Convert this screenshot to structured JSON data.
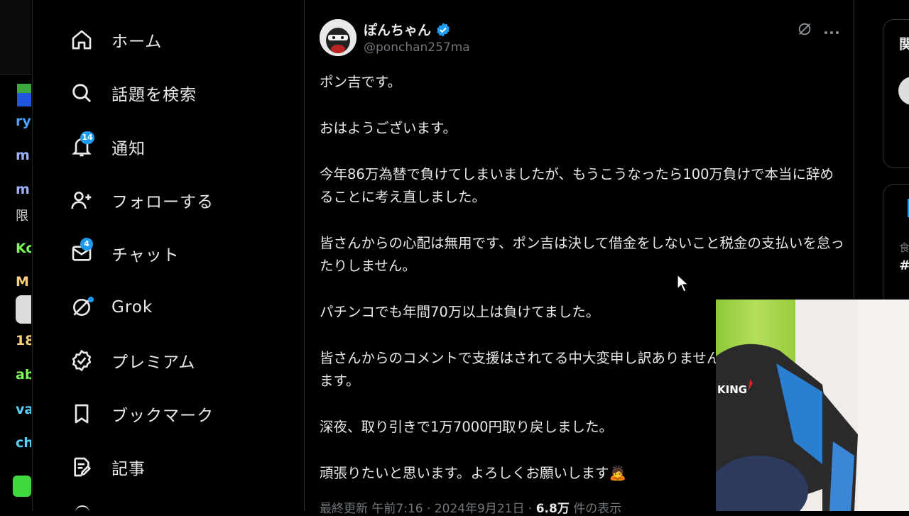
{
  "left_strip": {
    "items": [
      {
        "text": "ry",
        "color": "#4aa3ff"
      },
      {
        "text": "m",
        "color": "#9bb4ff"
      },
      {
        "text": "m",
        "color": "#9bb4ff"
      },
      {
        "text": "限",
        "color": "#cfcfcf"
      },
      {
        "text": "Ko",
        "color": "#7cfc5a"
      },
      {
        "text": "M",
        "color": "#ffd27a"
      },
      {
        "text": "18",
        "color": "#ffd27a"
      },
      {
        "text": "ab",
        "color": "#7cfc5a"
      },
      {
        "text": "va",
        "color": "#5ad0ff"
      },
      {
        "text": "ch",
        "color": "#5ad0ff"
      }
    ]
  },
  "nav": {
    "items": [
      {
        "label": "ホーム",
        "icon": "home-icon"
      },
      {
        "label": "話題を検索",
        "icon": "search-icon"
      },
      {
        "label": "通知",
        "icon": "bell-icon",
        "badge": "14"
      },
      {
        "label": "フォローする",
        "icon": "add-user-icon"
      },
      {
        "label": "チャット",
        "icon": "mail-icon",
        "badge": "4"
      },
      {
        "label": "Grok",
        "icon": "grok-icon"
      },
      {
        "label": "プレミアム",
        "icon": "premium-badge-icon"
      },
      {
        "label": "ブックマーク",
        "icon": "bookmark-icon"
      },
      {
        "label": "記事",
        "icon": "article-icon"
      }
    ]
  },
  "post": {
    "author_name": "ぽんちゃん",
    "author_handle": "@ponchan257ma",
    "paragraphs": [
      "ポン吉です。",
      "おはようございます。",
      "今年86万為替で負けてしまいましたが、もうこうなったら100万負けで本当に辞めることに考え直しました。",
      "皆さんからの心配は無用です、ポン吉は決して借金をしないこと税金の支払いを怠ったりしません。",
      "パチンコでも年間70万以上は負けてました。",
      "皆さんからのコメントで支援はされてる中大変申し訳ありません。ありがとうございます。",
      "深夜、取り引きで1万7000円取り戻しました。",
      "頑張りたいと思います。よろしくお願いします🙇"
    ],
    "meta_prefix": "最終更新 午前7:16 · 2024年9月21日 · ",
    "views": "6.8万",
    "views_suffix": " 件の表示"
  },
  "right_col": {
    "card1_char": "関",
    "card2_chars": [
      "食",
      "#"
    ]
  },
  "webcam": {
    "chair_logo": "KING"
  },
  "colors": {
    "accent": "#1d9bf0",
    "text": "#e7e9ea",
    "muted": "#71767b",
    "border": "#2f3336"
  }
}
